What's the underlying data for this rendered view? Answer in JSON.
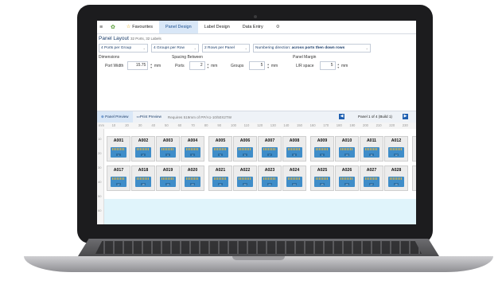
{
  "menubar": {
    "tabs": [
      {
        "label": "Favourites"
      },
      {
        "label": "Panel Design",
        "active": true
      },
      {
        "label": "Label Design"
      },
      {
        "label": "Data Entry"
      }
    ]
  },
  "layout": {
    "title": "Panel Layout",
    "subtitle": "32 Ports, 32 Labels",
    "selects": [
      {
        "value": "4 Ports per Group"
      },
      {
        "value": "4 Groups per Row"
      },
      {
        "value": "2 Rows per Panel"
      },
      {
        "label": "Numbering direction:",
        "value": "across ports then down rows"
      }
    ]
  },
  "dimensions": {
    "heading": "Dimensions",
    "port_width_label": "Port Width",
    "port_width_value": "15.75",
    "unit": "mm"
  },
  "spacing": {
    "heading": "Spacing Between",
    "ports_label": "Ports",
    "ports_value": "2",
    "groups_label": "Groups",
    "groups_value": "5",
    "unit": "mm"
  },
  "margin": {
    "heading": "Panel Margin",
    "lr_label": "L/R space",
    "lr_value": "5",
    "unit": "mm"
  },
  "preview_toolbar": {
    "panel_preview": "Panel Preview",
    "print_preview": "Print Preview",
    "requires": "Requires 519mm of PP/A1-10/50X2TW",
    "panel_of": "Panel 1 of 4 (Build 1)"
  },
  "ruler_top": [
    "mm",
    "10",
    "20",
    "30",
    "40",
    "50",
    "60",
    "70",
    "80",
    "90",
    "100",
    "110",
    "120",
    "130",
    "140",
    "150",
    "160",
    "170",
    "180",
    "190",
    "200",
    "210",
    "220",
    "230"
  ],
  "ruler_left": [
    "10",
    "20",
    "30",
    "40",
    "50",
    "60"
  ],
  "ports_row1": [
    "A001",
    "A002",
    "A003",
    "A004",
    "A005",
    "A006",
    "A007",
    "A008",
    "A009",
    "A010",
    "A011",
    "A012",
    "AC"
  ],
  "ports_row2": [
    "A017",
    "A018",
    "A019",
    "A020",
    "A021",
    "A022",
    "A023",
    "A024",
    "A025",
    "A026",
    "A027",
    "A028",
    "AC"
  ],
  "jack_numbers_row1": [
    "1",
    "2",
    "3",
    "4",
    "5",
    "6",
    "7",
    "8",
    "9",
    "10",
    "11",
    "12",
    ""
  ],
  "jack_numbers_row2": [
    "17",
    "18",
    "19",
    "20",
    "21",
    "22",
    "23",
    "24",
    "25",
    "26",
    "27",
    "28",
    ""
  ]
}
